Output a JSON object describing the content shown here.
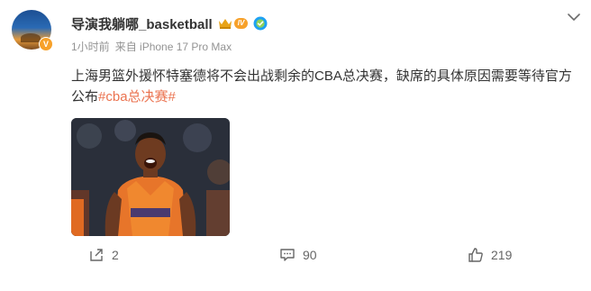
{
  "post": {
    "username": "导演我躺哪_basketball",
    "level_badge": "IV",
    "time": "1小时前",
    "source": "来自 iPhone 17 Pro Max",
    "text": "上海男篮外援怀特塞德将不会出战剩余的CBA总决赛，缺席的具体原因需要等待官方公布",
    "hashtag": "#cba总决赛#",
    "image_icon": "basketball-player-photo"
  },
  "actions": {
    "repost_count": "2",
    "comment_count": "90",
    "like_count": "219"
  },
  "colors": {
    "accent": "#eb7350",
    "badge": "#f7a12a",
    "verified": "#1da1f2"
  }
}
